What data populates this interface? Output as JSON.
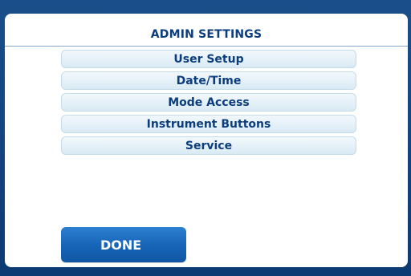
{
  "dialog": {
    "title": "ADMIN SETTINGS"
  },
  "menu": {
    "items": [
      {
        "label": "User Setup"
      },
      {
        "label": "Date/Time"
      },
      {
        "label": "Mode Access"
      },
      {
        "label": "Instrument Buttons"
      },
      {
        "label": "Service"
      }
    ]
  },
  "footer": {
    "done_label": "DONE"
  },
  "colors": {
    "frame": "#0e3f7a",
    "text": "#0b3d7d",
    "button": "#1663b6"
  }
}
